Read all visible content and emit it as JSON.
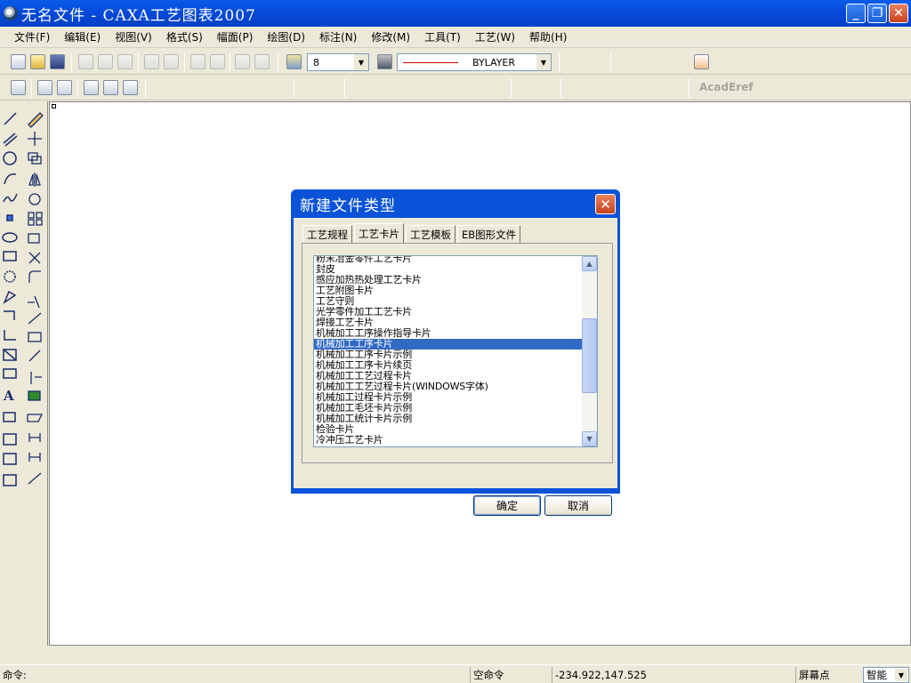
{
  "window": {
    "title": "无名文件 - CAXA工艺图表2007",
    "buttons": {
      "minimize": "_",
      "maximize": "❐",
      "close": "✕"
    }
  },
  "menubar": {
    "items": [
      {
        "label": "文件(F)"
      },
      {
        "label": "编辑(E)"
      },
      {
        "label": "视图(V)"
      },
      {
        "label": "格式(S)"
      },
      {
        "label": "幅面(P)"
      },
      {
        "label": "绘图(D)"
      },
      {
        "label": "标注(N)"
      },
      {
        "label": "修改(M)"
      },
      {
        "label": "工具(T)"
      },
      {
        "label": "工艺(W)"
      },
      {
        "label": "帮助(H)"
      }
    ]
  },
  "toolbar": {
    "layer_value": "8",
    "linetype_value": "BYLAYER",
    "acad_label": "AcadEref"
  },
  "dialog": {
    "title": "新建文件类型",
    "close_icon": "close-icon",
    "tabs": [
      {
        "label": "工艺规程",
        "active": false
      },
      {
        "label": "工艺卡片",
        "active": true
      },
      {
        "label": "工艺模板",
        "active": false
      },
      {
        "label": "EB图形文件",
        "active": false
      }
    ],
    "list_items": [
      "粉末冶金零件工艺卡片",
      "封皮",
      "感应加热热处理工艺卡片",
      "工艺附图卡片",
      "工艺守则",
      "光学零件加工工艺卡片",
      "焊接工艺卡片",
      "机械加工工序操作指导卡片",
      "机械加工工序卡片",
      "机械加工工序卡片示例",
      "机械加工工序卡片续页",
      "机械加工工艺过程卡片",
      "机械加工工艺过程卡片(WINDOWS字体)",
      "机械加工过程卡片示例",
      "机械加工毛坯卡片示例",
      "机械加工统计卡片示例",
      "检验卡片",
      "冷冲压工艺卡片"
    ],
    "selected_index": 8,
    "ok_label": "确定",
    "cancel_label": "取消"
  },
  "statusbar": {
    "command_label": "命令:",
    "command_state": "空命令",
    "coordinates": "-234.922,147.525",
    "snap_label": "屏幕点",
    "mode_value": "智能"
  },
  "colors": {
    "titlebar": "#0a5be8",
    "selection": "#316ac5",
    "chrome": "#ece9d8",
    "close": "#c8421c"
  }
}
